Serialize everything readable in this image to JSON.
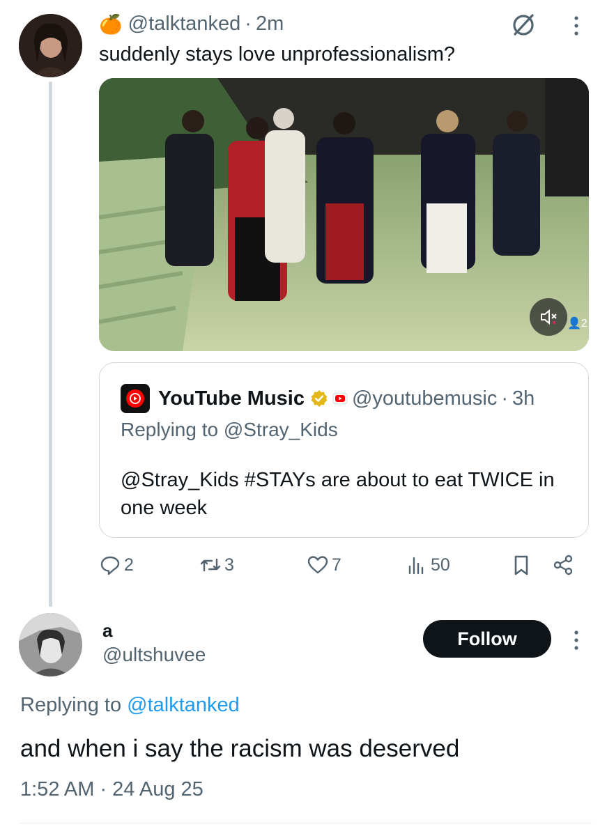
{
  "original_tweet": {
    "emoji": "🍊",
    "handle": "@talktanked",
    "separator": "·",
    "time": "2m",
    "text": "suddenly stays love unprofessionalism?",
    "icons": [
      "hide-icon",
      "more-icon"
    ],
    "media": {
      "type": "video",
      "muted": true,
      "viewers": "2"
    }
  },
  "quoted_tweet": {
    "display_name": "YouTube Music",
    "verified": true,
    "handle": "@youtubemusic",
    "separator": "·",
    "time": "3h",
    "replying_prefix": "Replying to ",
    "replying_to": "@Stray_Kids",
    "text": "@Stray_Kids #STAYs are about to eat TWICE in one week"
  },
  "actions": {
    "replies": "2",
    "retweets": "3",
    "likes": "7",
    "views": "50"
  },
  "reply_tweet": {
    "display_name": "a",
    "handle": "@ultshuvee",
    "follow_label": "Follow",
    "replying_prefix": "Replying to ",
    "replying_to": "@talktanked",
    "text": "and when i say the racism was deserved",
    "timestamp": "1:52 AM · 24 Aug 25"
  },
  "colors": {
    "text_primary": "#0f1419",
    "text_secondary": "#536471",
    "link": "#1d9bf0",
    "verified_gold": "#e2b719",
    "youtube_red": "#ff0000",
    "border": "#cfd9de"
  }
}
